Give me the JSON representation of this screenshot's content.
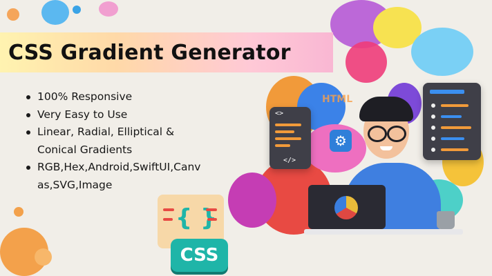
{
  "banner": {
    "title": "CSS Gradient Generator"
  },
  "features": [
    "100% Responsive",
    "Very Easy to Use",
    "Linear, Radial, Elliptical & Conical Gradients",
    "RGB,Hex,Android,SwiftUI,Canvas,SVG,Image"
  ],
  "badges": {
    "css_label": "CSS",
    "html_label": "HTML",
    "code_open": "<>",
    "code_close": "</>",
    "braces": "{ }"
  },
  "colors": {
    "banner_start": "#fff3b0",
    "banner_end": "#f9b7d3",
    "css_badge": "#1fb5a8",
    "card_bg": "#3f3f48",
    "shirt": "#3f7fe0"
  },
  "icons": [
    "code-icon",
    "gear-icon",
    "css-icon",
    "laptop-icon",
    "mug-icon",
    "html-icon"
  ]
}
